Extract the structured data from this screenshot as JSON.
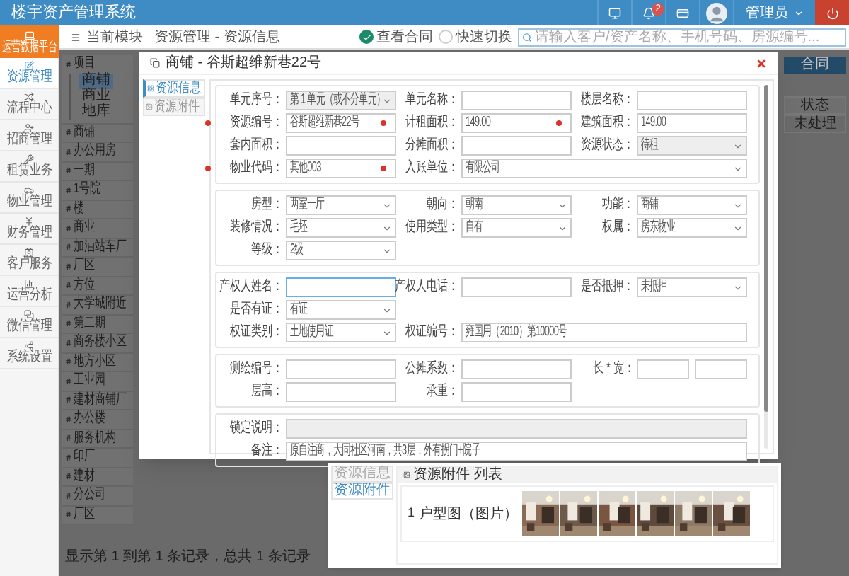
{
  "app_title": "楼宇资产管理系统",
  "header": {
    "notification_count": "2",
    "user": "管理员"
  },
  "platform_button": "运营数据平台",
  "breadcrumb": {
    "module": "当前模块",
    "path": "资源管理 - 资源信息"
  },
  "toolbar": {
    "options": [
      {
        "label": "查看合同",
        "checked": true
      },
      {
        "label": "快速切换",
        "checked": false
      }
    ],
    "search": {
      "placeholder": "请输入客户/资产名称、手机号码、房源编号..."
    }
  },
  "sidebar": {
    "items": [
      {
        "label": "资源管理",
        "selected": true
      },
      {
        "label": "流程中心",
        "selected": false
      },
      {
        "label": "招商管理",
        "selected": false
      },
      {
        "label": "租赁业务",
        "selected": false
      },
      {
        "label": "物业管理",
        "selected": false
      },
      {
        "label": "财务管理",
        "selected": false
      },
      {
        "label": "客户服务",
        "selected": false
      },
      {
        "label": "运营分析",
        "selected": false
      },
      {
        "label": "微信管理",
        "selected": false
      },
      {
        "label": "系统设置",
        "selected": false
      }
    ]
  },
  "tree": {
    "items": [
      {
        "label": "项目",
        "children": [
          {
            "label": "商铺",
            "selected": true
          },
          {
            "label": "商业",
            "selected": false
          },
          {
            "label": "地库",
            "selected": false
          }
        ]
      },
      {
        "label": "商铺"
      },
      {
        "label": "办公用房"
      },
      {
        "label": "一期"
      },
      {
        "label": "1号院"
      },
      {
        "label": "楼"
      },
      {
        "label": "商业"
      },
      {
        "label": "加油站车厂"
      },
      {
        "label": "厂区"
      },
      {
        "label": "方位"
      },
      {
        "label": "大学城附近"
      },
      {
        "label": "第二期"
      },
      {
        "label": "商务楼小区"
      },
      {
        "label": "地方小区"
      },
      {
        "label": "工业园"
      },
      {
        "label": "建材商铺厂"
      },
      {
        "label": "办公楼"
      },
      {
        "label": "服务机构"
      },
      {
        "label": "印厂"
      },
      {
        "label": "建材"
      },
      {
        "label": "分公司"
      },
      {
        "label": "厂区"
      }
    ]
  },
  "contract_button": "合同",
  "background_table": {
    "columns": [
      "状态"
    ],
    "rows": [
      [
        "未处理"
      ]
    ]
  },
  "footer_text": "显示第 1 到第 1 条记录，总共 1 条记录",
  "dialog": {
    "title": "商铺 - 谷斯超维新巷22号",
    "tabs": [
      {
        "label": "资源信息",
        "selected": true
      },
      {
        "label": "资源附件",
        "selected": false
      }
    ],
    "sections": [
      {
        "rows": [
          [
            {
              "label": "单元序号：",
              "kind": "select",
              "value": "第 1 单元（或不分单元）",
              "required": false,
              "disabled": true,
              "focused": false
            },
            {
              "label": "单元名称：",
              "kind": "input",
              "required": false,
              "disabled": false,
              "focused": false
            },
            {
              "label": "楼层名称：",
              "kind": "input",
              "required": false,
              "disabled": false,
              "focused": false
            }
          ],
          [
            {
              "label": "资源编号：",
              "kind": "input",
              "value": "谷斯超维新巷22号",
              "required": true,
              "disabled": false,
              "focused": false
            },
            {
              "label": "计租面积：",
              "kind": "input",
              "value": "149.00",
              "required": true,
              "disabled": false,
              "focused": false
            },
            {
              "label": "建筑面积：",
              "kind": "input",
              "value": "149.00",
              "required": true,
              "disabled": false,
              "focused": false
            }
          ],
          [
            {
              "label": "套内面积：",
              "kind": "input",
              "required": false,
              "disabled": false,
              "focused": false
            },
            {
              "label": "分摊面积：",
              "kind": "input",
              "required": false,
              "disabled": false,
              "focused": false
            },
            {
              "label": "资源状态：",
              "kind": "select",
              "value": "待租",
              "required": false,
              "disabled": true,
              "focused": false
            }
          ],
          [
            {
              "label": "物业代码：",
              "kind": "input",
              "value": "其他003",
              "required": true,
              "disabled": false,
              "focused": false
            },
            {
              "label": "入账单位：",
              "kind": "wide-select",
              "value": "有限公司",
              "required": true,
              "disabled": false,
              "focused": false
            }
          ]
        ]
      },
      {
        "rows": [
          [
            {
              "label": "房型：",
              "kind": "select",
              "value": "两室一厅",
              "required": false,
              "disabled": false,
              "focused": false
            },
            {
              "label": "朝向：",
              "kind": "select",
              "value": "朝南",
              "required": false,
              "disabled": false,
              "focused": false
            },
            {
              "label": "功能：",
              "kind": "select",
              "value": "商铺",
              "required": false,
              "disabled": false,
              "focused": false
            }
          ],
          [
            {
              "label": "装修情况：",
              "kind": "select",
              "value": "毛坯",
              "required": false,
              "disabled": false,
              "focused": false
            },
            {
              "label": "使用类型：",
              "kind": "select",
              "value": "自有",
              "required": false,
              "disabled": false,
              "focused": false
            },
            {
              "label": "权属：",
              "kind": "select",
              "value": "房东物业",
              "required": false,
              "disabled": false,
              "focused": false
            }
          ],
          [
            {
              "label": "等级：",
              "kind": "select",
              "value": "2级",
              "required": false,
              "disabled": false,
              "focused": false
            }
          ]
        ]
      },
      {
        "rows": [
          [
            {
              "label": "产权人姓名：",
              "kind": "input",
              "required": false,
              "disabled": false,
              "focused": true
            },
            {
              "label": "产权人电话：",
              "kind": "input",
              "required": false,
              "disabled": false,
              "focused": false
            },
            {
              "label": "是否抵押：",
              "kind": "select",
              "value": "未抵押",
              "required": false,
              "disabled": false,
              "focused": false
            }
          ],
          [
            {
              "label": "是否有证：",
              "kind": "select",
              "value": "有证",
              "required": false,
              "disabled": false,
              "focused": false
            }
          ],
          [
            {
              "label": "权证类别：",
              "kind": "select",
              "value": "土地使用证",
              "required": false,
              "disabled": false,
              "focused": false
            },
            {
              "label": "权证编号：",
              "kind": "wide-input",
              "value": "雍国用（2010）第10000号",
              "required": false,
              "disabled": false,
              "focused": false
            }
          ]
        ]
      },
      {
        "rows": [
          [
            {
              "label": "测绘编号：",
              "kind": "input",
              "required": false,
              "disabled": false,
              "focused": false
            },
            {
              "label": "公摊系数：",
              "kind": "input",
              "required": false,
              "disabled": false,
              "focused": false
            },
            {
              "label": "长 * 宽：",
              "kind": "pair-input",
              "required": false,
              "disabled": false,
              "focused": false
            }
          ],
          [
            {
              "label": "层高：",
              "kind": "input",
              "required": false,
              "disabled": false,
              "focused": false
            },
            {
              "label": "承重：",
              "kind": "input",
              "required": false,
              "disabled": false,
              "focused": false
            }
          ]
        ]
      },
      {
        "rows": [
          [
            {
              "label": "锁定说明：",
              "kind": "full-input",
              "required": false,
              "disabled": true,
              "focused": false
            }
          ],
          [
            {
              "label": "备注：",
              "kind": "full-input",
              "value": "原自注商，大同社区河南，共3层，外有拐门+院子",
              "required": false,
              "disabled": false,
              "focused": false
            }
          ]
        ]
      }
    ]
  },
  "attachment_panel": {
    "tabs": [
      {
        "label": "资源信息",
        "selected": false
      },
      {
        "label": "资源附件",
        "selected": true
      }
    ],
    "title": "资源附件 列表",
    "rows": [
      {
        "number": "1",
        "label": "户型图（图片）"
      }
    ]
  }
}
